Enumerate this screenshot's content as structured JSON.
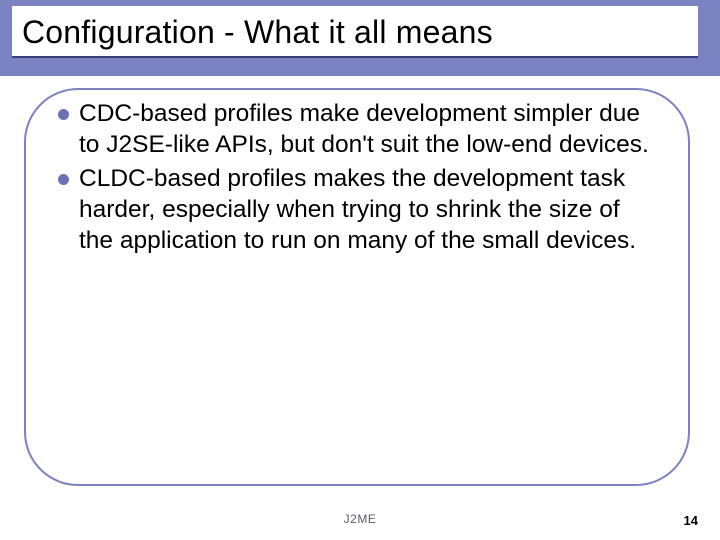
{
  "accent_color": "#7b82c2",
  "title": "Configuration - What it all means",
  "bullets": [
    "CDC-based profiles make development simpler due to J2SE-like APIs, but don't suit the low-end devices.",
    "CLDC-based profiles makes the development task harder, especially when trying to shrink the size of the application to run on many of the small devices."
  ],
  "footer": "J2ME",
  "page_number": "14"
}
